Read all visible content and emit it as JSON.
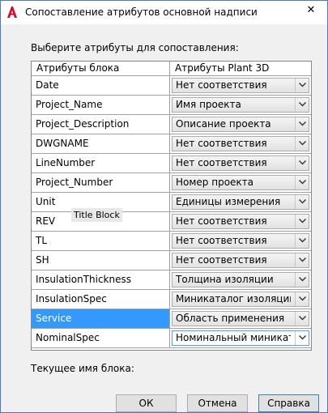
{
  "window": {
    "title": "Сопоставление атрибутов основной надписи",
    "close_glyph": "✕",
    "brand_color": "#c8102e"
  },
  "prompt": "Выберите атрибуты для сопоставления:",
  "grid": {
    "headers": [
      "Атрибуты блока",
      "Атрибуты Plant 3D"
    ],
    "rows": [
      {
        "block_attr": "Date",
        "plant_attr": "Нет соответствия"
      },
      {
        "block_attr": "Project_Name",
        "plant_attr": "Имя проекта"
      },
      {
        "block_attr": "Project_Description",
        "plant_attr": "Описание проекта"
      },
      {
        "block_attr": "DWGNAME",
        "plant_attr": "Нет соответствия"
      },
      {
        "block_attr": "LineNumber",
        "plant_attr": "Нет соответствия"
      },
      {
        "block_attr": "Project_Number",
        "plant_attr": "Номер проекта"
      },
      {
        "block_attr": "Unit",
        "plant_attr": "Единицы измерения"
      },
      {
        "block_attr": "REV",
        "plant_attr": "Нет соответствия"
      },
      {
        "block_attr": "TL",
        "plant_attr": "Нет соответствия"
      },
      {
        "block_attr": "SH",
        "plant_attr": "Нет соответствия"
      },
      {
        "block_attr": "InsulationThickness",
        "plant_attr": "Толщина изоляции"
      },
      {
        "block_attr": "InsulationSpec",
        "plant_attr": "Миникаталог изоляции"
      },
      {
        "block_attr": "Service",
        "plant_attr": "Область применения"
      },
      {
        "block_attr": "NominalSpec",
        "plant_attr": "Номинальный миниката..."
      }
    ],
    "selected_row": 12,
    "focused_row": 13
  },
  "tooltip": "Title Block",
  "current_block_label": "Текущее имя блока:",
  "buttons": {
    "ok": "ОК",
    "cancel": "Отмена",
    "help": "Справка"
  }
}
